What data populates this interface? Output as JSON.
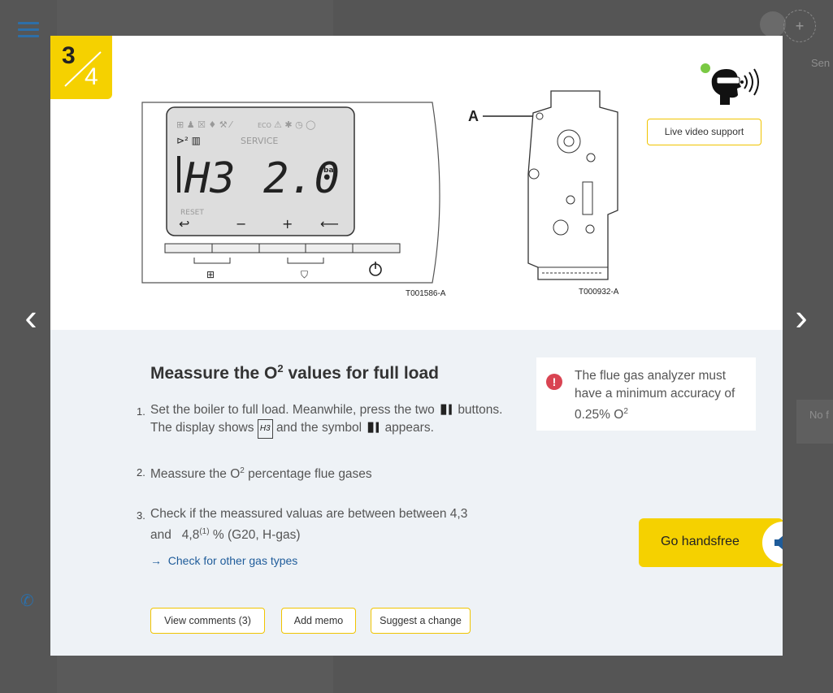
{
  "background": {
    "sidebar_right_text_1": "Sen",
    "sidebar_right_text_2": "No f"
  },
  "step": {
    "current": "3",
    "total": "4"
  },
  "illustration": {
    "display": {
      "code_left": "H3",
      "code_right": "2.0",
      "unit": "bar",
      "service": "SERVICE",
      "reset": "RESET",
      "eco": "ECO"
    },
    "caption_left": "T001586-A",
    "caption_right": "T000932-A",
    "valve_label": "A"
  },
  "live_support": {
    "label": "Live video support",
    "status_color": "#7ac943"
  },
  "content": {
    "title_prefix": "Meassure the O",
    "title_sup": "2",
    "title_suffix": " values for full load",
    "steps": [
      {
        "num": "1.",
        "text_a": "Set the boiler to full load. Meanwhile, press the two",
        "text_b": "buttons.",
        "text_c": "The display shows",
        "text_d": "and the symbol",
        "text_e": "appears.",
        "code": "H3"
      },
      {
        "num": "2.",
        "text_a": "Meassure the O",
        "sup": "2",
        "text_b": " percentage flue gases"
      },
      {
        "num": "3.",
        "text_a": "Check if the meassured valuas are between between 4,3",
        "text_b": "and   4,8",
        "sup": "(1)",
        "text_c": " % (G20, H-gas)"
      }
    ],
    "link": "Check for other gas types"
  },
  "warning": {
    "text_a": "The flue gas analyzer must have a minimum accuracy of 0.25% O",
    "sup": "2",
    "color": "#d94452"
  },
  "handsfree": {
    "label": "Go handsfree",
    "accent": "#f5d100"
  },
  "buttons": {
    "comments": "View comments (3)",
    "memo": "Add memo",
    "suggest": "Suggest a change"
  }
}
